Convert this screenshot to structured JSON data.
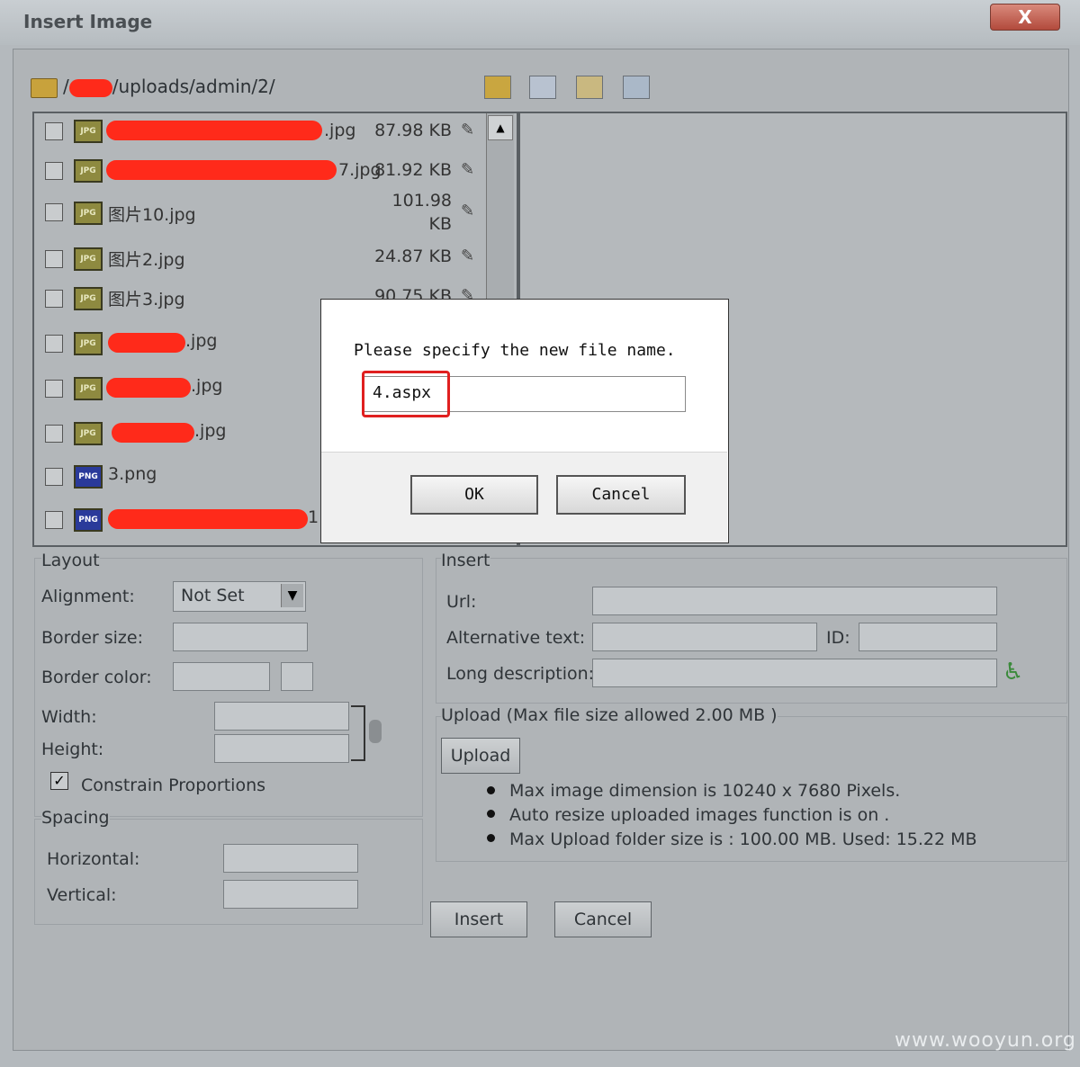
{
  "window": {
    "title": "Insert Image",
    "close_label": "X"
  },
  "path": {
    "prefix": "/",
    "rest": "/uploads/admin/2/"
  },
  "files": [
    {
      "name": ".jpg",
      "size": "87.98 KB",
      "type": "JPG"
    },
    {
      "name": "7.jpg",
      "size": "81.92 KB",
      "type": "JPG"
    },
    {
      "name": "图片10.jpg",
      "size": "101.98 KB",
      "type": "JPG"
    },
    {
      "name": "图片2.jpg",
      "size": "24.87 KB",
      "type": "JPG"
    },
    {
      "name": "图片3.jpg",
      "size": "90.75 KB",
      "type": "JPG"
    },
    {
      "name": ".jpg",
      "size": "",
      "type": "JPG"
    },
    {
      "name": ".jpg",
      "size": "",
      "type": "JPG"
    },
    {
      "name": ".jpg",
      "size": "",
      "type": "JPG"
    },
    {
      "name": "3.png",
      "size": "",
      "type": "PNG"
    },
    {
      "name": "1",
      "size": "",
      "type": "PNG"
    }
  ],
  "file_sizes_split": {
    "line1": "101.98",
    "line2": "KB"
  },
  "layout": {
    "heading": "Layout",
    "alignment_label": "Alignment:",
    "alignment_value": "Not Set",
    "border_size_label": "Border size:",
    "border_color_label": "Border color:",
    "width_label": "Width:",
    "height_label": "Height:",
    "constrain_label": "Constrain Proportions",
    "constrain_checked": true
  },
  "spacing": {
    "heading": "Spacing",
    "horizontal_label": "Horizontal:",
    "vertical_label": "Vertical:"
  },
  "insert": {
    "heading": "Insert",
    "url_label": "Url:",
    "alt_label": "Alternative text:",
    "id_label": "ID:",
    "longdesc_label": "Long description:"
  },
  "upload": {
    "heading": "Upload (Max file size allowed 2.00 MB )",
    "button": "Upload",
    "notes": [
      "Max image dimension is 10240 x 7680 Pixels.",
      "Auto resize uploaded images function is on .",
      "Max Upload folder size is : 100.00 MB. Used: 15.22 MB"
    ]
  },
  "buttons": {
    "insert": "Insert",
    "cancel": "Cancel"
  },
  "modal": {
    "message": "Please specify the new file name.",
    "value": "4.aspx",
    "ok": "OK",
    "cancel": "Cancel"
  },
  "watermark": "www.wooyun.org",
  "colors": {
    "highlight": "#e02020",
    "redaction": "#ff2a1a",
    "close": "#b24a3c"
  }
}
